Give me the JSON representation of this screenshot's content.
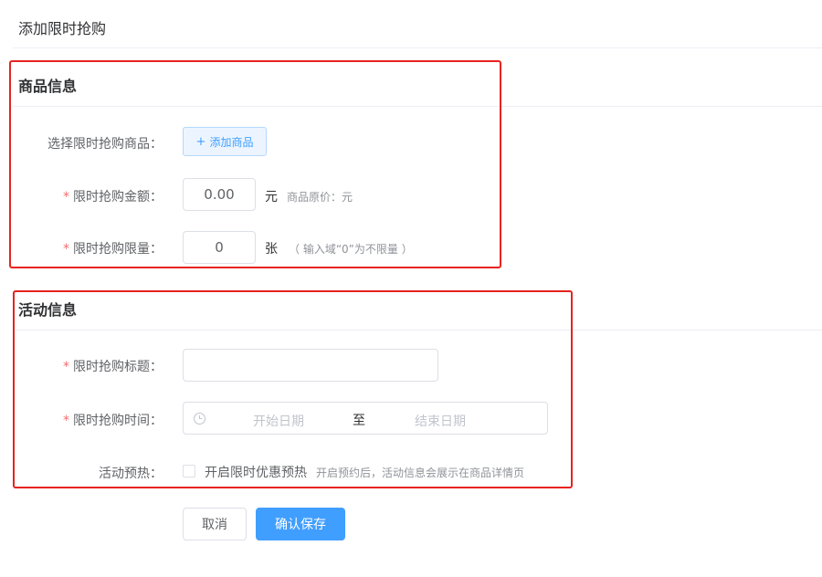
{
  "page": {
    "title": "添加限时抢购"
  },
  "goods_section": {
    "title": "商品信息",
    "select_label": "选择限时抢购商品：",
    "add_button": {
      "icon": "plus-icon",
      "plus": "+",
      "label": "添加商品"
    },
    "price_label": "限时抢购金额：",
    "price_value": "0.00",
    "price_unit": "元",
    "price_hint": "商品原价：元",
    "limit_label": "限时抢购限量：",
    "limit_value": "0",
    "limit_unit": "张",
    "limit_hint": "（ 输入域“0”为不限量 ）"
  },
  "activity_section": {
    "title": "活动信息",
    "title_label": "限时抢购标题：",
    "title_value": "",
    "time_label": "限时抢购时间：",
    "time_icon": "clock-icon",
    "start_placeholder": "开始日期",
    "range_separator": "至",
    "end_placeholder": "结束日期",
    "preheat_label": "活动预热：",
    "preheat_checkbox_label": "开启限时优惠预热",
    "preheat_checked": false,
    "preheat_hint": "开启预约后，活动信息会展示在商品详情页"
  },
  "actions": {
    "cancel": "取消",
    "save": "确认保存"
  },
  "colors": {
    "primary": "#409eff",
    "required": "#f56c6c",
    "highlight_box": "#e6231f"
  },
  "required_mark": "*"
}
